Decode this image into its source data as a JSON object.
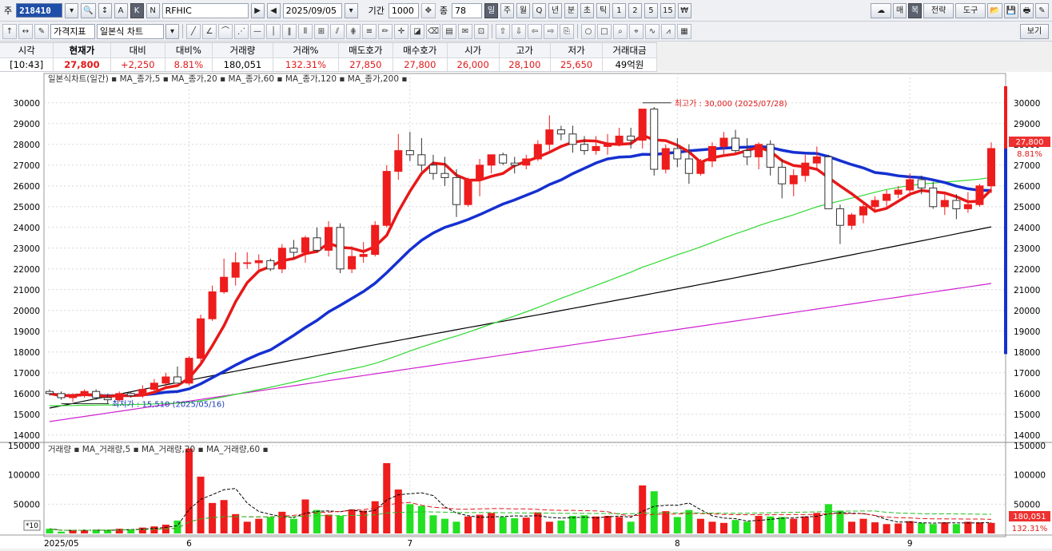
{
  "toolbar": {
    "market_label": "주",
    "code": "218410",
    "name": "RFHIC",
    "date": "2025/09/05",
    "period_label": "기간",
    "period_value": "1000",
    "count_label": "종",
    "count_value": "78",
    "timeframes": [
      "일",
      "주",
      "월",
      "Q",
      "년",
      "분",
      "초",
      "틱",
      "1",
      "2",
      "5",
      "15"
    ],
    "active_timeframe": "일",
    "mode_buttons": [
      "A",
      "K",
      "N"
    ],
    "right_buttons": [
      "매",
      "복",
      "전략",
      "도구"
    ],
    "indicator_label": "가격지표",
    "chart_type": "일본식 차트",
    "view_label": "보기"
  },
  "quote": {
    "headers": [
      "시각",
      "현재가",
      "대비",
      "대비%",
      "거래량",
      "거래%",
      "매도호가",
      "매수호가",
      "시가",
      "고가",
      "저가",
      "거래대금"
    ],
    "values": [
      "[10:43]",
      "27,800",
      "+2,250",
      "8.81%",
      "180,051",
      "132.31%",
      "27,850",
      "27,800",
      "26,000",
      "28,100",
      "25,650",
      "49억원"
    ]
  },
  "chart_data": {
    "type": "candlestick",
    "legend": "일본식차트(일간) ▪ MA_종가,5 ▪ MA_종가,20 ▪ MA_종가,60 ▪ MA_종가,120 ▪ MA_종가,200 ▪",
    "vol_legend": "거래량 ▪ MA_거래량,5 ▪ MA_거래량,20 ▪ MA_거래량,60 ▪",
    "ylim": [
      13800,
      30800
    ],
    "y_ticks": [
      14000,
      15000,
      16000,
      17000,
      18000,
      19000,
      20000,
      21000,
      22000,
      23000,
      24000,
      25000,
      26000,
      27000,
      28000,
      29000,
      30000
    ],
    "vol_ylim": [
      0,
      150000
    ],
    "vol_ticks": [
      50000,
      100000,
      150000
    ],
    "x_labels": [
      {
        "i": 0,
        "text": "2025/05"
      },
      {
        "i": 12,
        "text": "6"
      },
      {
        "i": 31,
        "text": "7"
      },
      {
        "i": 54,
        "text": "8"
      },
      {
        "i": 74,
        "text": "9"
      }
    ],
    "vol_scale_label": "*10",
    "high_note": "최고가 : 30,000 (2025/07/28)",
    "low_note": "최저가 : 15,510 (2025/05/16)",
    "last_price": "27,800",
    "last_change": "8.81%",
    "last_volume": "180,051",
    "last_volume_pct": "132.31%",
    "colors": {
      "up": "#ee1c1c",
      "down": "#1a2fd8",
      "vol_up": "#ee1c1c",
      "vol_down": "#22e022",
      "ma5": "#e81818",
      "ma20": "#1530d0",
      "ma60": "#30d830",
      "ma120": "#000000",
      "ma200": "#d020d0"
    },
    "candles": [
      [
        16100,
        16200,
        15900,
        16000,
        8000
      ],
      [
        16000,
        16100,
        15700,
        15800,
        3000
      ],
      [
        15800,
        16000,
        15600,
        15900,
        5000
      ],
      [
        15900,
        16200,
        15800,
        16100,
        6000
      ],
      [
        16100,
        16200,
        15700,
        15800,
        6000
      ],
      [
        15800,
        16000,
        15500,
        15700,
        6000
      ],
      [
        15700,
        16100,
        15600,
        16000,
        8000
      ],
      [
        16000,
        16100,
        15800,
        15900,
        7000
      ],
      [
        15900,
        16400,
        15800,
        16200,
        10000
      ],
      [
        16200,
        16700,
        16000,
        16500,
        12000
      ],
      [
        16500,
        17000,
        16300,
        16800,
        15000
      ],
      [
        16800,
        17300,
        16600,
        16500,
        22000
      ],
      [
        16500,
        17800,
        16400,
        17700,
        145000
      ],
      [
        17700,
        19800,
        17500,
        19600,
        97000
      ],
      [
        19600,
        21200,
        19500,
        20900,
        52000
      ],
      [
        20900,
        22500,
        20800,
        21600,
        57000
      ],
      [
        21600,
        22800,
        21200,
        22300,
        33000
      ],
      [
        22300,
        22800,
        22000,
        22300,
        20000
      ],
      [
        22300,
        22700,
        21800,
        22400,
        25000
      ],
      [
        22400,
        22500,
        21900,
        22000,
        28000
      ],
      [
        22000,
        23200,
        21800,
        23000,
        37000
      ],
      [
        23000,
        23400,
        22500,
        22800,
        25000
      ],
      [
        22800,
        23600,
        22300,
        23500,
        58000
      ],
      [
        23500,
        24000,
        22800,
        22900,
        40000
      ],
      [
        22900,
        24300,
        22600,
        24000,
        32000
      ],
      [
        24000,
        24200,
        21800,
        22000,
        30000
      ],
      [
        22000,
        23100,
        21800,
        22600,
        41000
      ],
      [
        22600,
        23300,
        22300,
        22700,
        39000
      ],
      [
        22700,
        24300,
        22600,
        24100,
        55000
      ],
      [
        24100,
        27000,
        24000,
        26700,
        120000
      ],
      [
        26700,
        28500,
        26300,
        27700,
        75000
      ],
      [
        27700,
        28600,
        27200,
        27500,
        50000
      ],
      [
        27500,
        28300,
        26700,
        27000,
        47000
      ],
      [
        27000,
        27500,
        26300,
        26600,
        31000
      ],
      [
        26600,
        27400,
        26000,
        26400,
        25000
      ],
      [
        26400,
        26800,
        24500,
        25100,
        20000
      ],
      [
        25100,
        26400,
        25000,
        26300,
        29000
      ],
      [
        26300,
        27300,
        25500,
        27000,
        32000
      ],
      [
        27000,
        27500,
        26600,
        27500,
        35000
      ],
      [
        27500,
        27600,
        27000,
        27100,
        28000
      ],
      [
        27100,
        27400,
        26600,
        27000,
        26000
      ],
      [
        27000,
        27500,
        26800,
        27300,
        27000
      ],
      [
        27300,
        28200,
        27200,
        28000,
        36000
      ],
      [
        28000,
        29400,
        27700,
        28700,
        20000
      ],
      [
        28700,
        28900,
        28200,
        28500,
        22000
      ],
      [
        28500,
        28900,
        27600,
        28000,
        30000
      ],
      [
        28000,
        28400,
        27500,
        27700,
        31000
      ],
      [
        27700,
        28400,
        27500,
        27900,
        29000
      ],
      [
        27900,
        28500,
        27500,
        28000,
        30000
      ],
      [
        28000,
        28800,
        27900,
        28400,
        28000
      ],
      [
        28400,
        28800,
        27800,
        28200,
        20000
      ],
      [
        28200,
        29000,
        27800,
        29700,
        82000
      ],
      [
        29700,
        29800,
        26500,
        26800,
        72000
      ],
      [
        26800,
        28000,
        26600,
        27800,
        38000
      ],
      [
        27800,
        28300,
        26900,
        27300,
        28000
      ],
      [
        27300,
        28000,
        26100,
        26600,
        40000
      ],
      [
        26600,
        27300,
        26500,
        27200,
        25000
      ],
      [
        27200,
        28100,
        26900,
        27900,
        20000
      ],
      [
        27900,
        28600,
        27500,
        28300,
        18000
      ],
      [
        28300,
        28700,
        27600,
        27700,
        23000
      ],
      [
        27700,
        28300,
        27000,
        27400,
        20000
      ],
      [
        27400,
        28100,
        26800,
        28000,
        30000
      ],
      [
        28000,
        28200,
        26500,
        26900,
        29000
      ],
      [
        26900,
        27300,
        25400,
        26100,
        28000
      ],
      [
        26100,
        26800,
        25500,
        26500,
        25000
      ],
      [
        26500,
        27500,
        26200,
        27100,
        29000
      ],
      [
        27100,
        27900,
        26800,
        27400,
        35000
      ],
      [
        27400,
        27500,
        25000,
        24900,
        50000
      ],
      [
        24900,
        25100,
        23200,
        24100,
        39000
      ],
      [
        24100,
        24700,
        23900,
        24600,
        20000
      ],
      [
        24600,
        25200,
        24200,
        25000,
        25000
      ],
      [
        25000,
        25500,
        24700,
        25300,
        19000
      ],
      [
        25300,
        25800,
        24900,
        25600,
        16000
      ],
      [
        25600,
        26000,
        25400,
        25800,
        17000
      ],
      [
        25800,
        26600,
        25500,
        26300,
        21000
      ],
      [
        26300,
        26500,
        25600,
        25900,
        18000
      ],
      [
        25900,
        26200,
        24900,
        25000,
        16000
      ],
      [
        25000,
        25700,
        24600,
        25300,
        19000
      ],
      [
        25300,
        25600,
        24400,
        24900,
        16000
      ],
      [
        24900,
        25700,
        24700,
        25100,
        20000
      ],
      [
        25100,
        26100,
        25000,
        26000,
        19000
      ],
      [
        26000,
        28100,
        25650,
        27800,
        18005
      ]
    ]
  }
}
